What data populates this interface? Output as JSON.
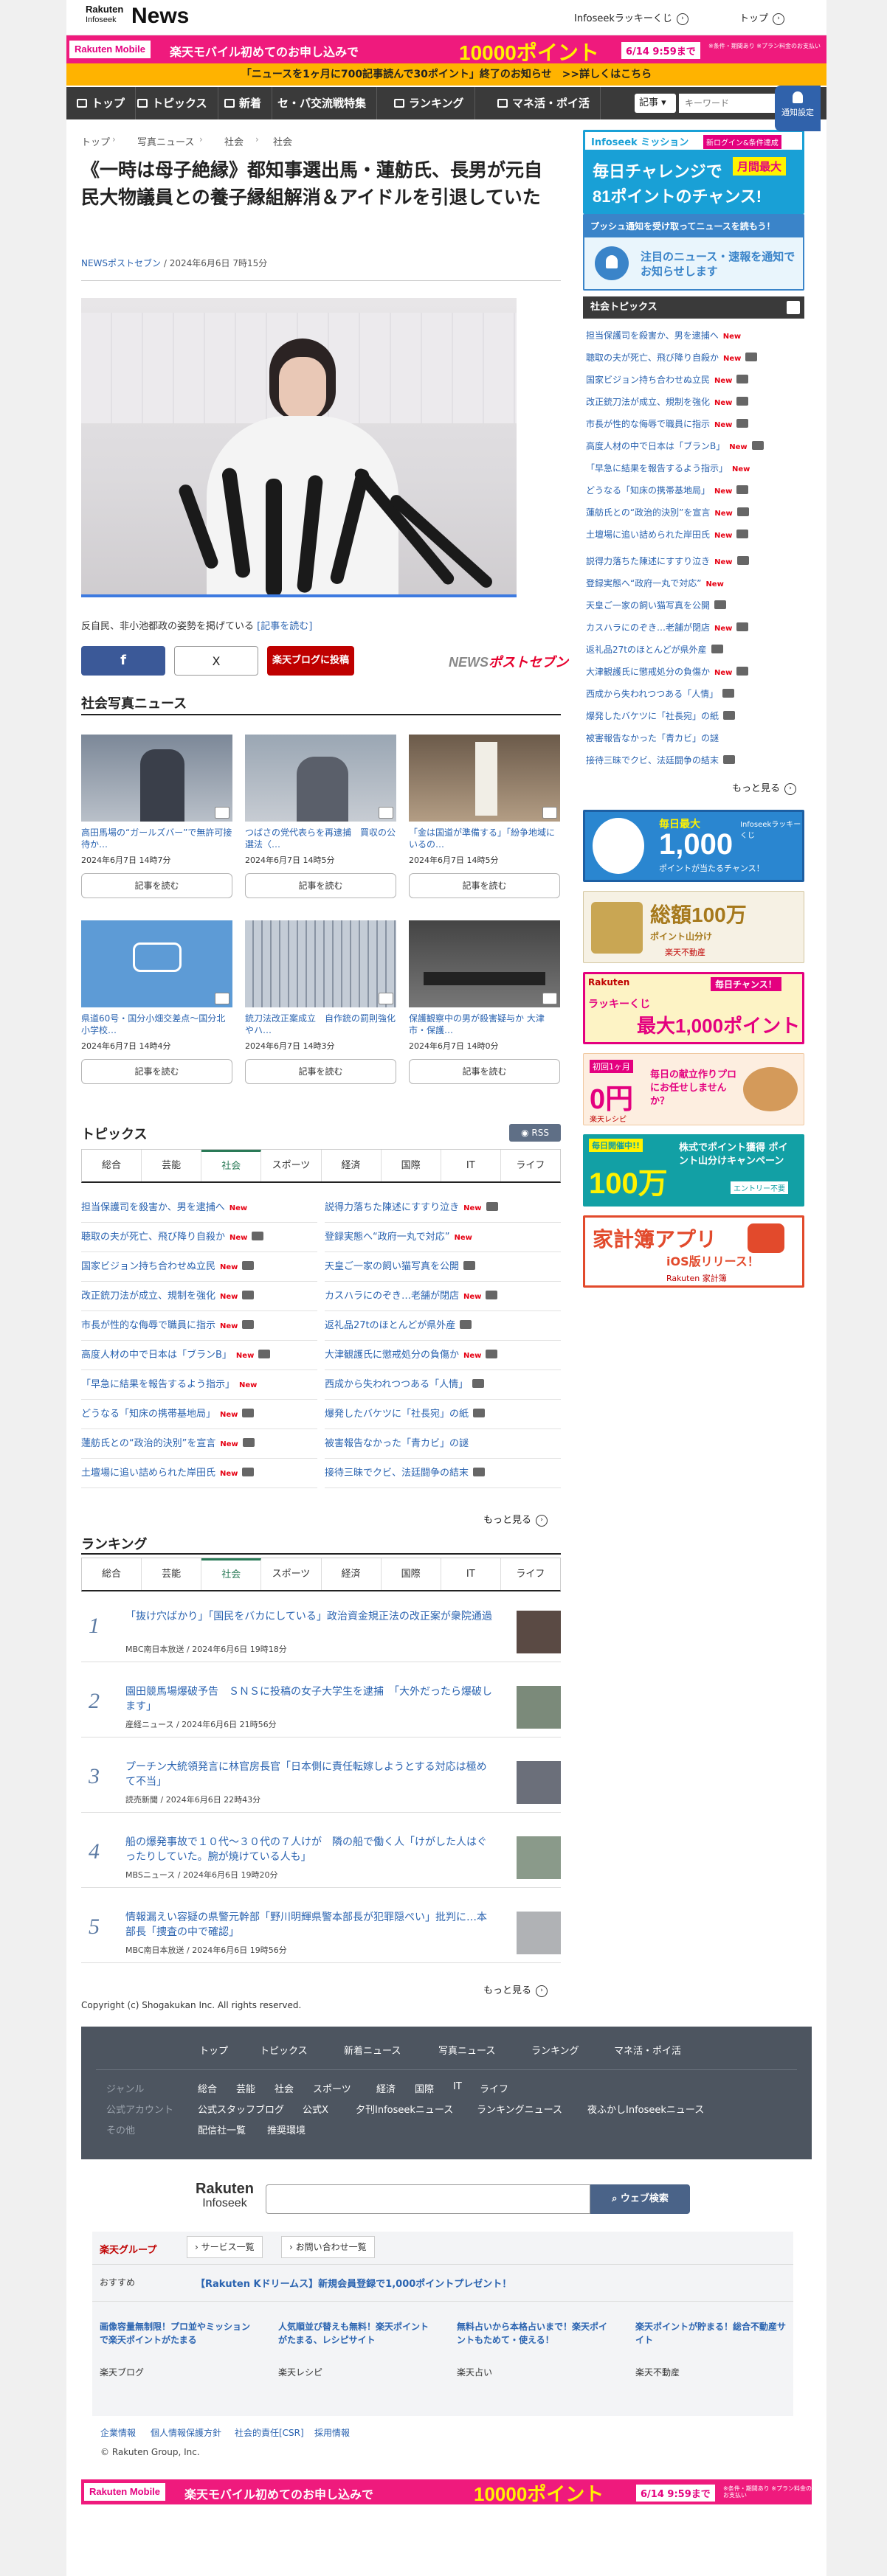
{
  "header": {
    "logo_top": "Rakuten",
    "logo_bottom": "Infoseek",
    "logo_news": "News",
    "lucky_link": "Infoseekラッキーくじ",
    "top_link": "トップ"
  },
  "promo_banner": {
    "logo": "Rakuten Mobile",
    "text": "楽天モバイル初めてのお申し込みで",
    "points": "10000ポイント",
    "date": "6/14 9:59まで",
    "note": "※条件・期間あり ※プラン料金のお支払い"
  },
  "notice_bar": "「ニュースを1ヶ月に700記事読んで30ポイント」終了のお知らせ　>>詳しくはこちら",
  "nav": {
    "items": [
      "トップ",
      "トピックス",
      "新着",
      "セ・パ交流戦特集",
      "ランキング",
      "マネ活・ポイ活"
    ],
    "search_select": "記事",
    "search_placeholder": "キーワード"
  },
  "notify_button": "通知設定",
  "breadcrumb": [
    "トップ",
    "写真ニュース",
    "社会",
    "社会"
  ],
  "article": {
    "title": "《一時は母子絶縁》都知事選出馬・蓮舫氏、長男が元自民大物議員との養子縁組解消＆アイドルを引退していた",
    "source": "NEWSポストセブン",
    "date": " / 2024年6月6日 7時15分",
    "caption": "反自民、非小池都政の姿勢を掲げている",
    "caption_link": "[記事を読む]",
    "share_fb": "f",
    "share_x": "X",
    "share_blog": "楽天ブログに投稿",
    "brand_logo_a": "NEWS",
    "brand_logo_b": "ポストセブン"
  },
  "photo_news": {
    "heading": "社会写真ニュース",
    "items": [
      {
        "title": "高田馬場の“ガールズバー”で無許可接待か…",
        "date": "2024年6月7日 14時7分",
        "button": "記事を読む"
      },
      {
        "title": "つばさの党代表らを再逮捕　買収の公選法〈…",
        "date": "2024年6月7日 14時5分",
        "button": "記事を読む"
      },
      {
        "title": "「金は国道が準備する」「紛争地域にいるの…",
        "date": "2024年6月7日 14時5分",
        "button": "記事を読む"
      },
      {
        "title": "県道60号・国分小畑交差点〜国分北小学校…",
        "date": "2024年6月7日 14時4分",
        "button": "記事を読む"
      },
      {
        "title": "銃刀法改正案成立　自作銃の罰則強化やハ…",
        "date": "2024年6月7日 14時3分",
        "button": "記事を読む"
      },
      {
        "title": "保護観察中の男が殺害疑与か 大津市・保護…",
        "date": "2024年6月7日 14時0分",
        "button": "記事を読む"
      }
    ]
  },
  "topics": {
    "heading": "トピックス",
    "rss": "RSS",
    "tabs": [
      "総合",
      "芸能",
      "社会",
      "スポーツ",
      "経済",
      "国際",
      "IT",
      "ライフ"
    ],
    "active_tab": "社会",
    "left": [
      {
        "text": "担当保護司を殺害か、男を逮捕へ",
        "new": "New",
        "cam": false
      },
      {
        "text": "聴取の夫が死亡、飛び降り自殺か",
        "new": "New",
        "cam": true
      },
      {
        "text": "国家ビジョン持ち合わせぬ立民",
        "new": "New",
        "cam": true
      },
      {
        "text": "改正銃刀法が成立、規制を強化",
        "new": "New",
        "cam": true
      },
      {
        "text": "市長が性的な侮辱で職員に指示",
        "new": "New",
        "cam": true
      },
      {
        "text": "高度人材の中で日本は「ブランB」",
        "new": "New",
        "cam": true
      },
      {
        "text": "「早急に結果を報告するよう指示」",
        "new": "New",
        "cam": false
      },
      {
        "text": "どうなる「知床の携帯基地局」",
        "new": "New",
        "cam": true
      },
      {
        "text": "蓮舫氏との“政治的決別”を宣言",
        "new": "New",
        "cam": true
      },
      {
        "text": "土壇場に追い詰められた岸田氏",
        "new": "New",
        "cam": true
      }
    ],
    "right": [
      {
        "text": "説得力落ちた陳述にすすり泣き",
        "new": "New",
        "cam": true
      },
      {
        "text": "登録実態へ“政府一丸で対応”",
        "new": "New",
        "cam": false
      },
      {
        "text": "天皇ご一家の飼い猫写真を公開",
        "new": "",
        "cam": true
      },
      {
        "text": "カスハラにのぞき…老舗が閉店",
        "new": "New",
        "cam": true
      },
      {
        "text": "返礼品27tのほとんどが県外産",
        "new": "",
        "cam": true
      },
      {
        "text": "大津観護氏に懲戒処分の負傷か",
        "new": "New",
        "cam": true
      },
      {
        "text": "西成から失われつつある「人情」",
        "new": "",
        "cam": true
      },
      {
        "text": "爆発したバケツに「社長宛」の紙",
        "new": "",
        "cam": true
      },
      {
        "text": "被害報告なかった「青カビ」の謎",
        "new": "",
        "cam": false
      },
      {
        "text": "接待三昧でクビ、法廷闘争の結末",
        "new": "",
        "cam": true
      }
    ],
    "more": "もっと見る"
  },
  "ranking": {
    "heading": "ランキング",
    "tabs": [
      "総合",
      "芸能",
      "社会",
      "スポーツ",
      "経済",
      "国際",
      "IT",
      "ライフ"
    ],
    "active_tab": "社会",
    "items": [
      {
        "num": "1",
        "title": "「抜け穴ばかり」「国民をバカにしている」政治資金規正法の改正案が衆院通過",
        "meta": "MBC南日本放送 / 2024年6月6日 19時18分"
      },
      {
        "num": "2",
        "title": "園田競馬場爆破予告　ＳＮＳに投稿の女子大学生を逮捕　「大外だったら爆破します」",
        "meta": "産経ニュース / 2024年6月6日 21時56分"
      },
      {
        "num": "3",
        "title": "プーチン大統領発言に林官房長官「日本側に責任転嫁しようとする対応は極めて不当」",
        "meta": "読売新聞 / 2024年6月6日 22時43分"
      },
      {
        "num": "4",
        "title": "船の爆発事故で１０代〜３０代の７人けが　隣の船で働く人「けがした人はぐったりしていた。腕が焼けている人も」",
        "meta": "MBSニュース / 2024年6月6日 19時20分"
      },
      {
        "num": "5",
        "title": "情報漏えい容疑の県警元幹部「野川明輝県警本部長が犯罪隠ぺい」批判に…本部長「捜査の中で確認」",
        "meta": "MBC南日本放送 / 2024年6月6日 19時56分"
      }
    ],
    "more": "もっと見る"
  },
  "copyright": "Copyright (c) Shogakukan Inc. All rights reserved.",
  "footer": {
    "nav": [
      "トップ",
      "トピックス",
      "新着ニュース",
      "写真ニュース",
      "ランキング",
      "マネ活・ポイ活"
    ],
    "genre_label": "ジャンル",
    "genres": [
      "総合",
      "芸能",
      "社会",
      "スポーツ",
      "経済",
      "国際",
      "IT",
      "ライフ"
    ],
    "accounts_label": "公式アカウント",
    "accounts": [
      "公式スタッフブログ",
      "公式X",
      "夕刊Infoseekニュース",
      "ランキングニュース",
      "夜ふかしInfoseekニュース"
    ],
    "other_label": "その他",
    "others": [
      "配信社一覧",
      "推奨環境"
    ],
    "rakuten_logo_a": "Rakuten",
    "rakuten_logo_b": "Infoseek",
    "web_search": "ウェブ検索",
    "group": "楽天グループ",
    "service_list": "サービス一覧",
    "contact": "お問い合わせ一覧",
    "recommend_label": "おすすめ",
    "recommend_promo": "【Rakuten Kドリームス】新規会員登録で1,000ポイントプレゼント！",
    "promos": [
      {
        "title": "画像容量無制限！プロ並やミッションで楽天ポイントがたまる",
        "src": "楽天ブログ"
      },
      {
        "title": "人気順並び替えも無料！楽天ポイントがたまる、レシピサイト",
        "src": "楽天レシピ"
      },
      {
        "title": "無料占いから本格占いまで！楽天ポイントもためて・使える！",
        "src": "楽天占い"
      },
      {
        "title": "楽天ポイントが貯まる！総合不動産サイト",
        "src": "楽天不動産"
      }
    ],
    "legal": [
      "企業情報",
      "個人情報保護方針",
      "社会的責任[CSR]",
      "採用情報"
    ],
    "copyright": "© Rakuten Group, Inc."
  },
  "sidebar": {
    "mission_title": "Infoseek ミッション",
    "mission_tag": "新ログイン&条件達成",
    "mission_main": "毎日チャレンジで",
    "mission_badge": "月間最大",
    "mission_points": "81ポイントのチャンス!",
    "push_title": "プッシュ通知を受け取ってニュースを読もう！",
    "push_main": "注目のニュース・速報を通知でお知らせします",
    "topics_heading": "社会トピックス",
    "topics": [
      {
        "text": "担当保護司を殺害か、男を逮捕へ",
        "new": "New",
        "cam": false
      },
      {
        "text": "聴取の夫が死亡、飛び降り自殺か",
        "new": "New",
        "cam": true
      },
      {
        "text": "国家ビジョン持ち合わせぬ立民",
        "new": "New",
        "cam": true
      },
      {
        "text": "改正銃刀法が成立、規制を強化",
        "new": "New",
        "cam": true
      },
      {
        "text": "市長が性的な侮辱で職員に指示",
        "new": "New",
        "cam": true
      },
      {
        "text": "高度人材の中で日本は「ブランB」",
        "new": "New",
        "cam": true
      },
      {
        "text": "「早急に結果を報告するよう指示」",
        "new": "New",
        "cam": false
      },
      {
        "text": "どうなる「知床の携帯基地局」",
        "new": "New",
        "cam": true
      },
      {
        "text": "蓮舫氏との“政治的決別”を宣言",
        "new": "New",
        "cam": true
      },
      {
        "text": "土壇場に追い詰められた岸田氏",
        "new": "New",
        "cam": true
      },
      {
        "text": "説得力落ちた陳述にすすり泣き",
        "new": "New",
        "cam": true
      },
      {
        "text": "登録実態へ“政府一丸で対応”",
        "new": "New",
        "cam": false
      },
      {
        "text": "天皇ご一家の飼い猫写真を公開",
        "new": "",
        "cam": true
      },
      {
        "text": "カスハラにのぞき…老舗が閉店",
        "new": "New",
        "cam": true
      },
      {
        "text": "返礼品27tのほとんどが県外産",
        "new": "",
        "cam": true
      },
      {
        "text": "大津観護氏に懲戒処分の負傷か",
        "new": "New",
        "cam": true
      },
      {
        "text": "西成から失われつつある「人情」",
        "new": "",
        "cam": true
      },
      {
        "text": "爆発したバケツに「社長宛」の紙",
        "new": "",
        "cam": true
      },
      {
        "text": "被害報告なかった「青カビ」の謎",
        "new": "",
        "cam": false
      },
      {
        "text": "接待三昧でクビ、法廷闘争の結末",
        "new": "",
        "cam": true
      }
    ],
    "more": "もっと見る",
    "ads": [
      {
        "top": "毎日最大",
        "big": "1,000",
        "sub": "ポイントが当たるチャンス！",
        "name": "Infoseekラッキーくじ"
      },
      {
        "top": "総額100万ポイント",
        "big": "総額100万",
        "sub": "ポイント山分け",
        "name": "楽天不動産"
      },
      {
        "top": "毎日チャンス！",
        "big": "最大1,000ポイント",
        "sub": "ラッキーくじ",
        "name": "Rakuten"
      },
      {
        "top": "初回1ヶ月",
        "big": "0円",
        "sub": "毎日の献立作りプロにお任せしませんか？",
        "name": "楽天レシピ"
      },
      {
        "top": "毎日開催中!!",
        "big": "100万",
        "sub": "株式でポイント獲得 ポイント山分けキャンペーン",
        "name": "エントリー不要"
      },
      {
        "top": "家計簿アプリ",
        "big": "家計簿アプリ",
        "sub": "iOS版リリース！",
        "name": "Rakuten 家計簿"
      }
    ]
  },
  "colors": {
    "accent_pink": "#ef1a7d",
    "notice_yellow": "#ffb300",
    "nav_dark": "#3a3a3a",
    "link_blue": "#2a63b0",
    "new_red": "#e60012",
    "active_tab_green": "#2a7a57"
  }
}
